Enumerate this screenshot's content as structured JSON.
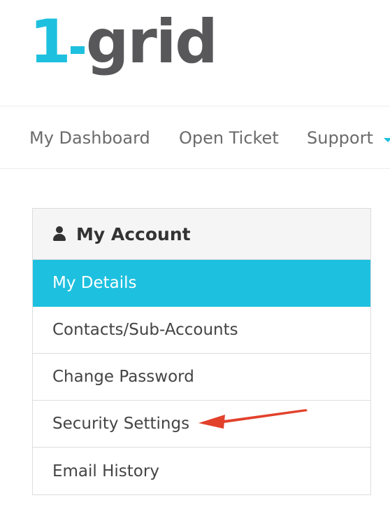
{
  "logo": {
    "one": "1",
    "word": "grid",
    "accent_color": "#1ec0df",
    "word_color": "#58585a"
  },
  "nav": {
    "items": [
      {
        "label": "My Dashboard"
      },
      {
        "label": "Open Ticket"
      },
      {
        "label": "Support"
      }
    ],
    "support_dropdown_icon": "caret-down-icon"
  },
  "account_panel": {
    "icon": "user-icon",
    "title": "My Account",
    "items": [
      {
        "label": "My Details",
        "active": true
      },
      {
        "label": "Contacts/Sub-Accounts",
        "active": false
      },
      {
        "label": "Change Password",
        "active": false
      },
      {
        "label": "Security Settings",
        "active": false
      },
      {
        "label": "Email History",
        "active": false
      }
    ],
    "active_color": "#1ec0df"
  },
  "annotation": {
    "type": "arrow",
    "color": "#e2412b",
    "points_to": "Security Settings"
  }
}
